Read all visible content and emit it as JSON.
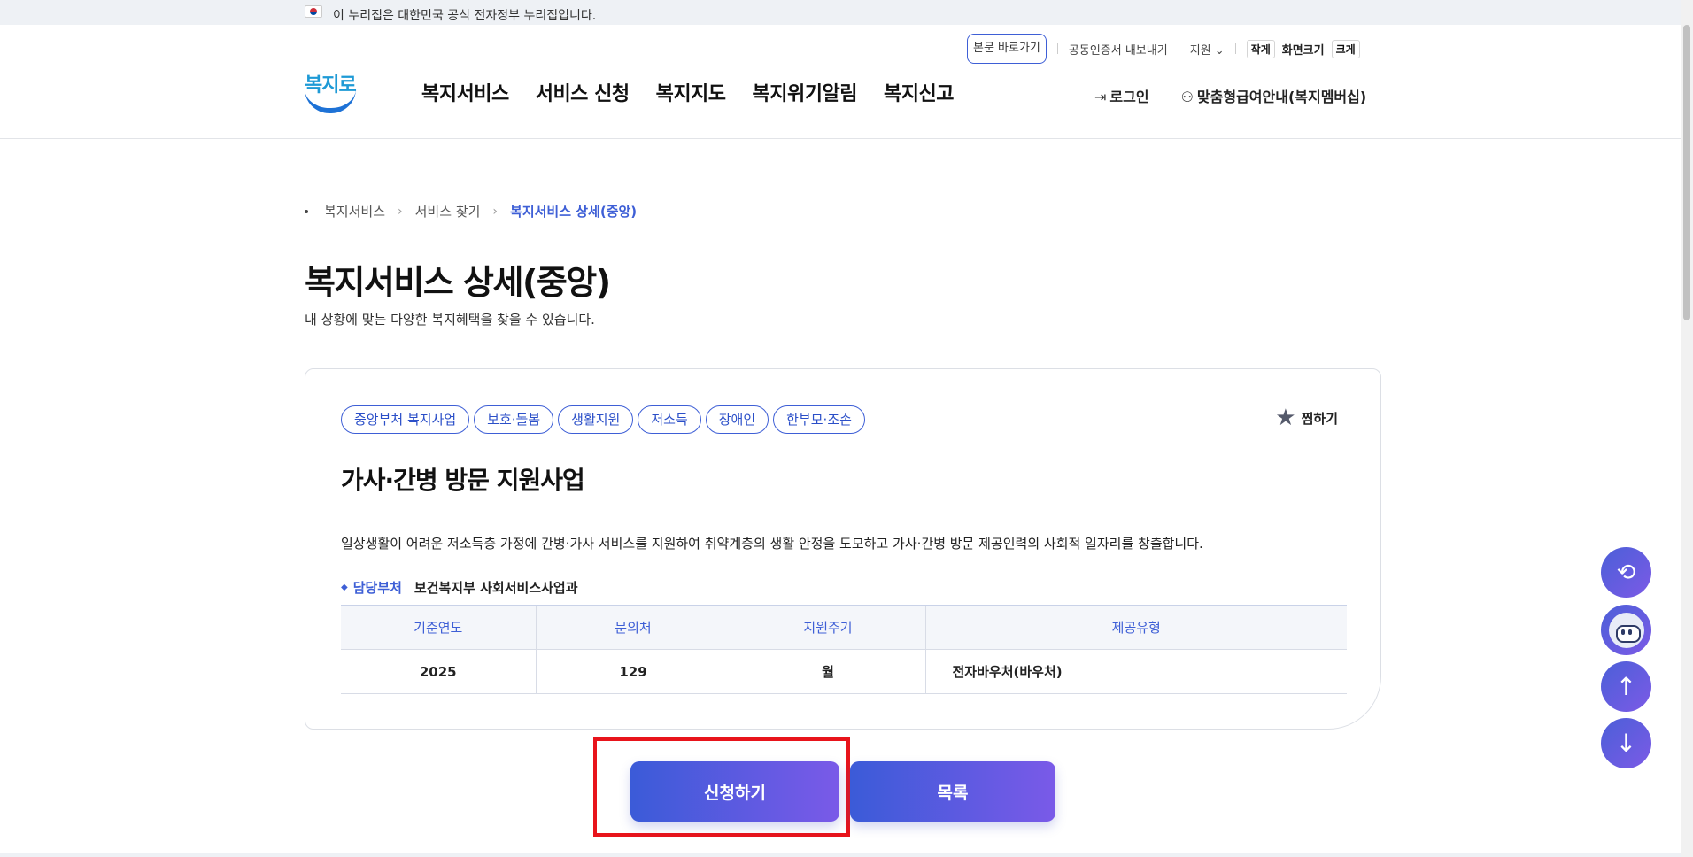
{
  "gov_banner": {
    "text": "이 누리집은 대한민국 공식 전자정부 누리집입니다."
  },
  "util_nav": {
    "skip_link": "본문 바로가기",
    "cert_export": "공동인증서 내보내기",
    "support": "지원",
    "font_small": "작게",
    "font_size_label": "화면크기",
    "font_large": "크게"
  },
  "logo": {
    "text": "복지로"
  },
  "gnb": [
    "복지서비스",
    "서비스 신청",
    "복지지도",
    "복지위기알림",
    "복지신고"
  ],
  "header_right": {
    "login": "로그인",
    "membership": "맞춤형급여안내(복지멤버십)"
  },
  "breadcrumb": [
    "복지서비스",
    "서비스 찾기",
    "복지서비스 상세(중앙)"
  ],
  "page": {
    "title": "복지서비스 상세(중앙)",
    "subtitle": "내 상황에 맞는 다양한 복지혜택을 찾을 수 있습니다."
  },
  "card": {
    "tags": [
      "중앙부처 복지사업",
      "보호·돌봄",
      "생활지원",
      "저소득",
      "장애인",
      "한부모·조손"
    ],
    "favorite": "찜하기",
    "title": "가사·간병 방문 지원사업",
    "description": "일상생활이 어려운 저소득층 가정에 간병·가사 서비스를 지원하여 취약계층의 생활 안정을 도모하고 가사·간병 방문 제공인력의 사회적 일자리를 창출합니다.",
    "dept_label": "담당부처",
    "dept_value": "보건복지부 사회서비스사업과",
    "table": {
      "headers": [
        "기준연도",
        "문의처",
        "지원주기",
        "제공유형"
      ],
      "row": [
        "2025",
        "129",
        "월",
        "전자바우처(바우처)"
      ]
    }
  },
  "buttons": {
    "apply": "신청하기",
    "list": "목록"
  },
  "colors": {
    "accent": "#3e5fd6",
    "highlight": "#e8141b"
  }
}
